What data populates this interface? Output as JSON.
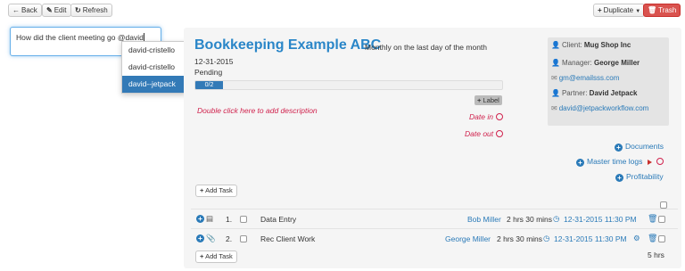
{
  "toolbar": {
    "back_label": "Back",
    "edit_label": "Edit",
    "refresh_label": "Refresh",
    "duplicate_label": "Duplicate",
    "trash_label": "Trash"
  },
  "note": {
    "value": "How did the client meeting go @david"
  },
  "mention_dropdown": {
    "items": [
      "david-cristello",
      "david-cristello",
      "david--jetpack"
    ],
    "selected_index": 2
  },
  "job": {
    "title": "Bookkeeping Example ABC",
    "recurrence": "Monthly on the last day of the month",
    "date": "12-31-2015",
    "status": "Pending",
    "progress_text": "0/2",
    "progress_fraction": 0.09,
    "label_button": "Label",
    "description_placeholder": "Double click here to add description",
    "date_in_label": "Date in",
    "date_out_label": "Date out"
  },
  "client_info": {
    "client_label": "Client:",
    "client_name": "Mug Shop Inc",
    "manager_label": "Manager:",
    "manager_name": "George Miller",
    "manager_email": "gm@emailsss.com",
    "partner_label": "Partner:",
    "partner_name": "David Jetpack",
    "partner_email": "david@jetpackworkflow.com"
  },
  "links": {
    "documents": "Documents",
    "master_time_logs": "Master time logs",
    "profitability": "Profitability"
  },
  "tasks": {
    "add_task_label": "Add Task",
    "rows": [
      {
        "num": "1.",
        "name": "Data Entry",
        "assignee": "Bob Miller",
        "duration": "2 hrs 30 mins",
        "due": "12-31-2015 11:30 PM"
      },
      {
        "num": "2.",
        "name": "Rec Client Work",
        "assignee": "George Miller",
        "duration": "2 hrs 30 mins",
        "due": "12-31-2015 11:30 PM"
      }
    ],
    "total": "5 hrs"
  },
  "colors": {
    "link": "#2a7ab8",
    "title": "#2a86c8",
    "accent_red": "#d0224d",
    "danger": "#d9534f",
    "selected": "#337ab7"
  }
}
